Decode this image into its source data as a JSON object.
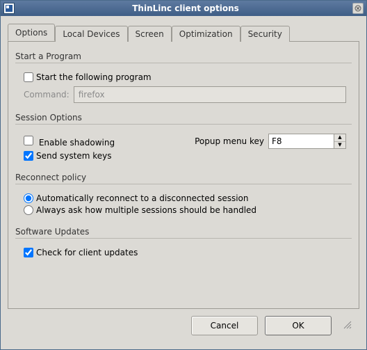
{
  "window": {
    "title": "ThinLinc client options"
  },
  "tabs": [
    {
      "label": "Options"
    },
    {
      "label": "Local Devices"
    },
    {
      "label": "Screen"
    },
    {
      "label": "Optimization"
    },
    {
      "label": "Security"
    }
  ],
  "groups": {
    "start_program": {
      "title": "Start a Program",
      "start_following": "Start the following program",
      "command_label": "Command:",
      "command_value": "firefox"
    },
    "session": {
      "title": "Session Options",
      "enable_shadowing": "Enable shadowing",
      "send_system_keys": "Send system keys",
      "popup_label": "Popup menu key",
      "popup_value": "F8"
    },
    "reconnect": {
      "title": "Reconnect policy",
      "auto": "Automatically reconnect to a disconnected session",
      "ask": "Always ask how multiple sessions should be handled"
    },
    "updates": {
      "title": "Software Updates",
      "check": "Check for client updates"
    }
  },
  "buttons": {
    "cancel": "Cancel",
    "ok": "OK"
  }
}
